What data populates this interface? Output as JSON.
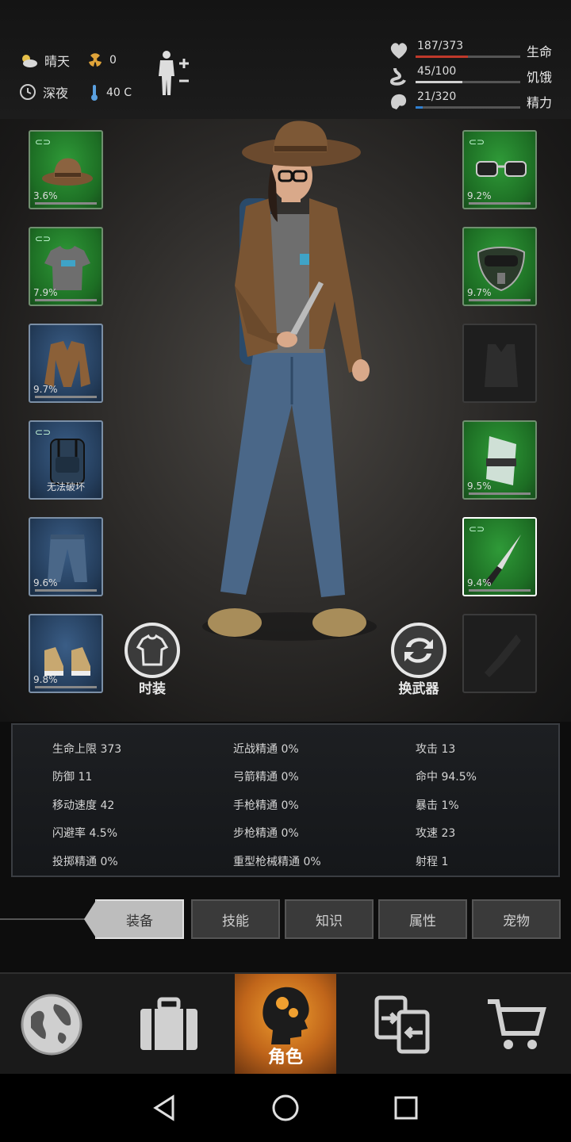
{
  "status": {
    "weather": "晴天",
    "radiation": "0",
    "time_of_day": "深夜",
    "temperature": "40 C"
  },
  "vitals": [
    {
      "value": "187/373",
      "label": "生命",
      "fill": 0.5,
      "color": "#c0392b"
    },
    {
      "value": "45/100",
      "label": "饥饿",
      "fill": 0.45,
      "color": "#d0d0d0"
    },
    {
      "value": "21/320",
      "label": "精力",
      "fill": 0.07,
      "color": "#2f7fd0"
    }
  ],
  "left_slots": [
    {
      "name": "hat",
      "pct": "3.6%",
      "style": "green",
      "linked": true
    },
    {
      "name": "shirt",
      "pct": "7.9%",
      "style": "green",
      "linked": true
    },
    {
      "name": "jacket",
      "pct": "9.7%",
      "style": "blue",
      "linked": false
    },
    {
      "name": "backpack",
      "pct": "",
      "note": "无法破坏",
      "style": "blue",
      "linked": true
    },
    {
      "name": "jeans",
      "pct": "9.6%",
      "style": "blue",
      "linked": false
    },
    {
      "name": "sneakers",
      "pct": "9.8%",
      "style": "blue",
      "linked": false
    }
  ],
  "right_slots": [
    {
      "name": "glasses",
      "pct": "9.2%",
      "style": "green",
      "linked": true
    },
    {
      "name": "face-mask",
      "pct": "9.7%",
      "style": "green",
      "linked": false
    },
    {
      "name": "vest",
      "pct": "",
      "style": "empty",
      "linked": false
    },
    {
      "name": "arm-wrap",
      "pct": "9.5%",
      "style": "green",
      "linked": false
    },
    {
      "name": "knife",
      "pct": "9.4%",
      "style": "green",
      "linked": true
    },
    {
      "name": "offhand",
      "pct": "",
      "style": "empty",
      "linked": false
    }
  ],
  "buttons": {
    "fashion": "时装",
    "swap_weapon": "换武器"
  },
  "stats": [
    [
      "生命上限 373",
      "近战精通 0%",
      "攻击 13"
    ],
    [
      "防御 11",
      "弓箭精通 0%",
      "命中 94.5%"
    ],
    [
      "移动速度 42",
      "手枪精通 0%",
      "暴击 1%"
    ],
    [
      "闪避率 4.5%",
      "步枪精通 0%",
      "攻速 23"
    ],
    [
      "投掷精通 0%",
      "重型枪械精通 0%",
      "射程 1"
    ]
  ],
  "tabs": [
    "装备",
    "技能",
    "知识",
    "属性",
    "宠物"
  ],
  "nav": {
    "character_label": "角色"
  }
}
